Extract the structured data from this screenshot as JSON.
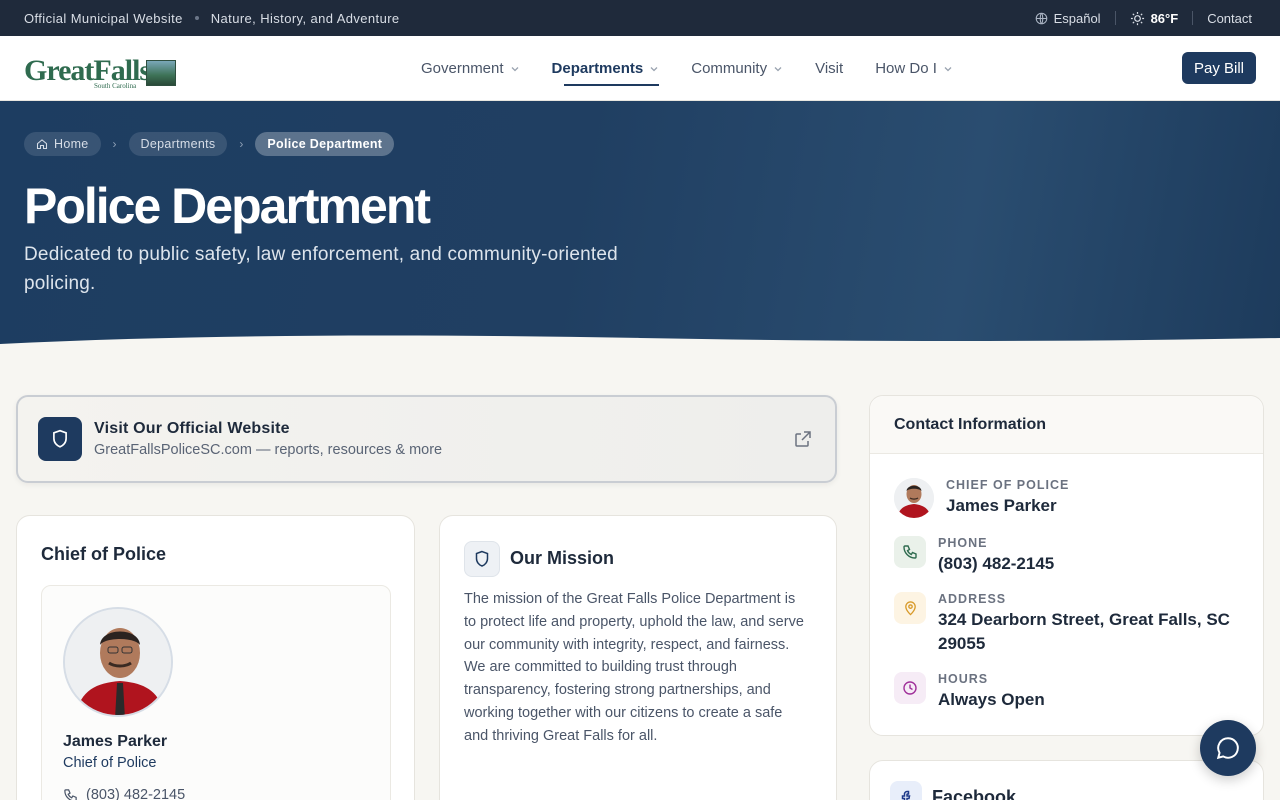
{
  "utility": {
    "left_text_1": "Official Municipal Website",
    "left_text_2": "Nature, History, and Adventure",
    "language": "Español",
    "weather": "86°F",
    "contact": "Contact"
  },
  "header": {
    "logo_text": "GreatFalls",
    "logo_sub": "South Carolina",
    "nav": [
      {
        "label": "Government",
        "dropdown": true,
        "active": false
      },
      {
        "label": "Departments",
        "dropdown": true,
        "active": true
      },
      {
        "label": "Community",
        "dropdown": true,
        "active": false
      },
      {
        "label": "Visit",
        "dropdown": false,
        "active": false
      },
      {
        "label": "How Do I",
        "dropdown": true,
        "active": false
      }
    ],
    "pay_bill": "Pay Bill"
  },
  "hero": {
    "breadcrumb": [
      "Home",
      "Departments",
      "Police Department"
    ],
    "title": "Police Department",
    "lead": "Dedicated to public safety, law enforcement, and community-oriented policing."
  },
  "website_card": {
    "title": "Visit Our Official Website",
    "subtitle": "GreatFallsPoliceSC.com — reports, resources & more"
  },
  "chief": {
    "section_title": "Chief of Police",
    "name": "James Parker",
    "role": "Chief of Police",
    "phone": "(803) 482-2145"
  },
  "mission": {
    "title": "Our Mission",
    "body": "The mission of the Great Falls Police Department is to protect life and property, uphold the law, and serve our community with integrity, respect, and fairness. We are committed to building trust through transparency, fostering strong partnerships, and working together with our citizens to create a safe and thriving Great Falls for all."
  },
  "contact": {
    "title": "Contact Information",
    "rows": [
      {
        "label": "CHIEF OF POLICE",
        "value": "James Parker"
      },
      {
        "label": "PHONE",
        "value": "(803) 482-2145"
      },
      {
        "label": "ADDRESS",
        "value": "324 Dearborn Street, Great Falls, SC 29055"
      },
      {
        "label": "HOURS",
        "value": "Always Open"
      }
    ]
  },
  "facebook": {
    "title": "Facebook"
  },
  "colors": {
    "primary": "#1e3a5f",
    "topbar": "#1f2a3b",
    "background": "#f7f6f2"
  }
}
